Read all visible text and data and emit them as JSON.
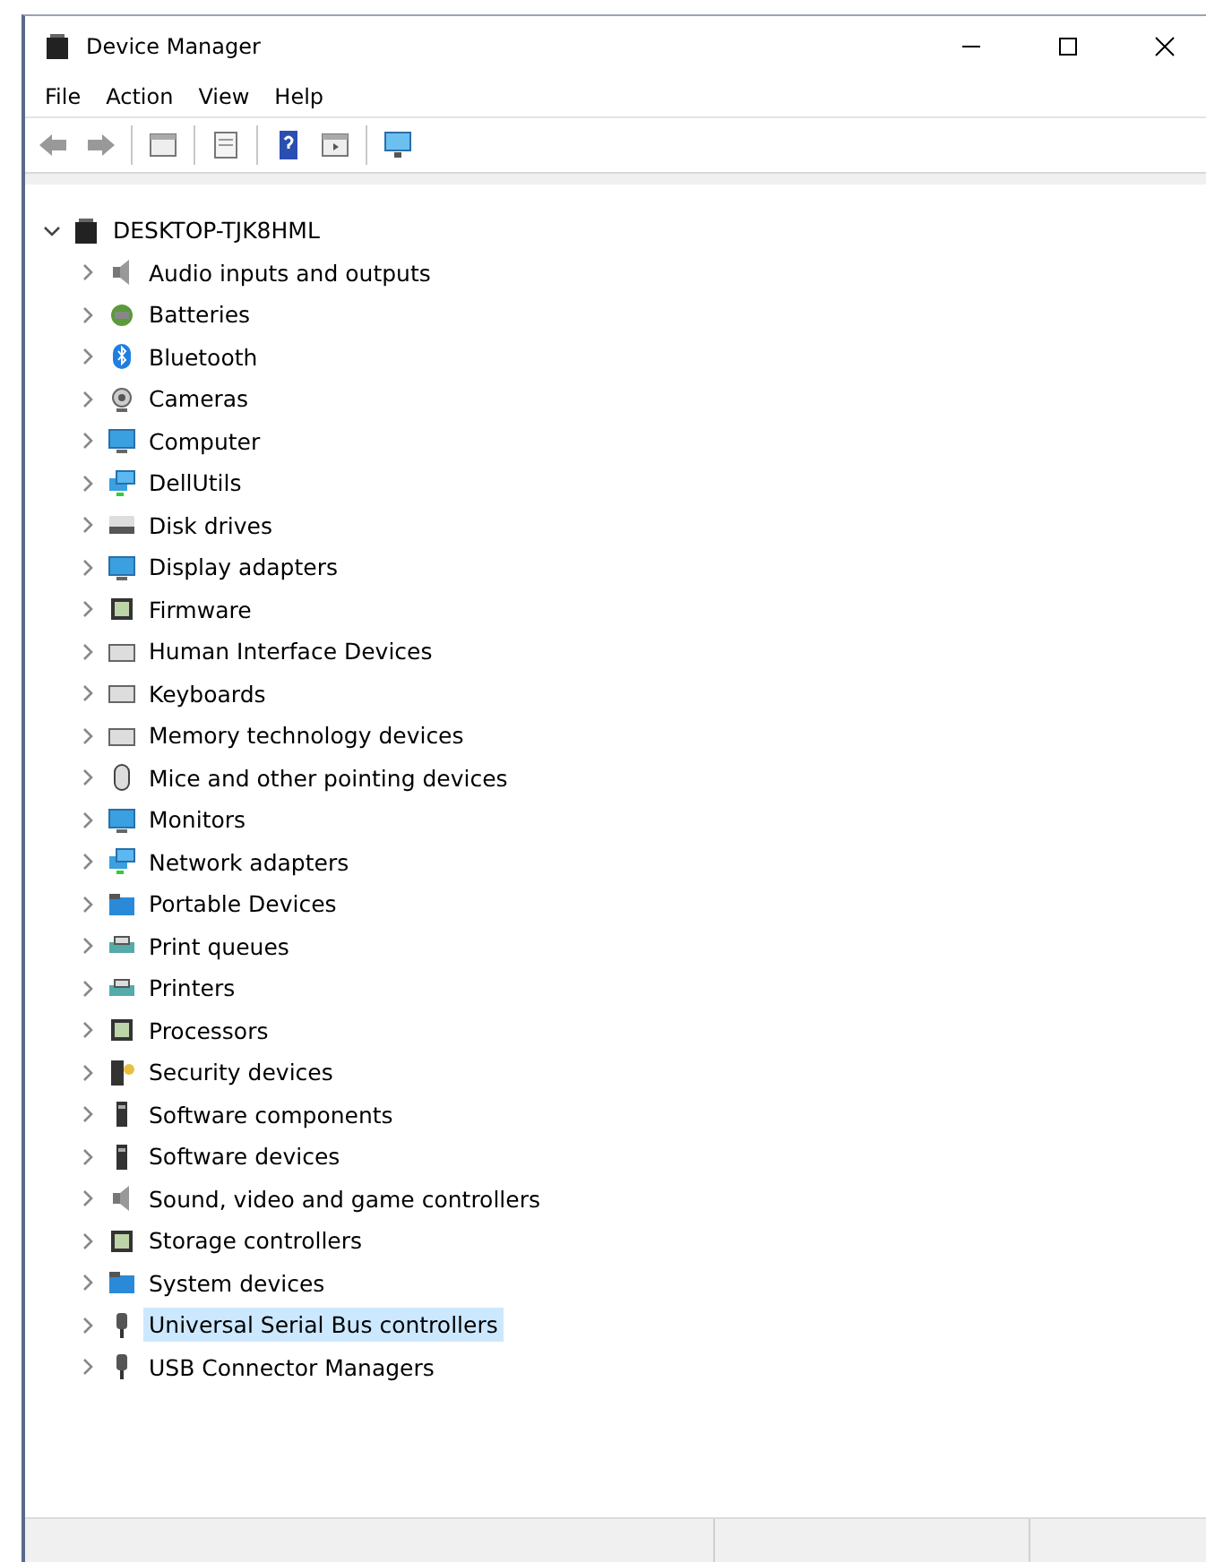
{
  "window": {
    "title": "Device Manager"
  },
  "menu": [
    "File",
    "Action",
    "View",
    "Help"
  ],
  "tree": {
    "label": "DESKTOP-TJK8HML",
    "expanded": true,
    "selected": false,
    "children": [
      {
        "label": "Audio inputs and outputs",
        "expanded": false,
        "selected": false
      },
      {
        "label": "Batteries",
        "expanded": false,
        "selected": false
      },
      {
        "label": "Bluetooth",
        "expanded": false,
        "selected": false
      },
      {
        "label": "Cameras",
        "expanded": false,
        "selected": false
      },
      {
        "label": "Computer",
        "expanded": false,
        "selected": false
      },
      {
        "label": "DellUtils",
        "expanded": false,
        "selected": false
      },
      {
        "label": "Disk drives",
        "expanded": false,
        "selected": false
      },
      {
        "label": "Display adapters",
        "expanded": false,
        "selected": false
      },
      {
        "label": "Firmware",
        "expanded": false,
        "selected": false
      },
      {
        "label": "Human Interface Devices",
        "expanded": false,
        "selected": false
      },
      {
        "label": "Keyboards",
        "expanded": false,
        "selected": false
      },
      {
        "label": "Memory technology devices",
        "expanded": false,
        "selected": false
      },
      {
        "label": "Mice and other pointing devices",
        "expanded": false,
        "selected": false
      },
      {
        "label": "Monitors",
        "expanded": false,
        "selected": false
      },
      {
        "label": "Network adapters",
        "expanded": false,
        "selected": false
      },
      {
        "label": "Portable Devices",
        "expanded": false,
        "selected": false
      },
      {
        "label": "Print queues",
        "expanded": false,
        "selected": false
      },
      {
        "label": "Printers",
        "expanded": false,
        "selected": false
      },
      {
        "label": "Processors",
        "expanded": false,
        "selected": false
      },
      {
        "label": "Security devices",
        "expanded": false,
        "selected": false
      },
      {
        "label": "Software components",
        "expanded": false,
        "selected": false
      },
      {
        "label": "Software devices",
        "expanded": false,
        "selected": false
      },
      {
        "label": "Sound, video and game controllers",
        "expanded": false,
        "selected": false
      },
      {
        "label": "Storage controllers",
        "expanded": false,
        "selected": false
      },
      {
        "label": "System devices",
        "expanded": false,
        "selected": false
      },
      {
        "label": "Universal Serial Bus controllers",
        "expanded": false,
        "selected": true
      },
      {
        "label": "USB Connector Managers",
        "expanded": false,
        "selected": false
      }
    ]
  }
}
